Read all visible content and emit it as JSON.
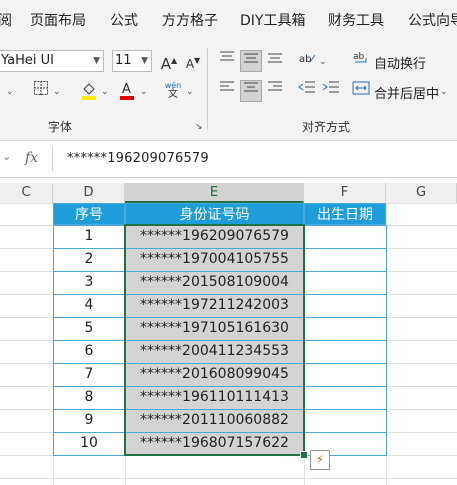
{
  "ribbon_tabs": [
    "阅",
    "页面布局",
    "公式",
    "方方格子",
    "DIY工具箱",
    "财务工具",
    "公式向导"
  ],
  "font_group": {
    "font_name": "YaHei UI",
    "font_size": "11",
    "label": "字体",
    "grow_font": "A",
    "shrink_font": "A",
    "phonetic_top": "wén",
    "phonetic_bottom": "文"
  },
  "align_group": {
    "label": "对齐方式",
    "wrap_text": "自动换行",
    "merge_center": "合并后居中"
  },
  "formula_bar": {
    "fx": "fx",
    "value": "******196209076579"
  },
  "columns": [
    "C",
    "D",
    "E",
    "F",
    "G"
  ],
  "table": {
    "headers": [
      "序号",
      "身份证号码",
      "出生日期"
    ],
    "rows": [
      {
        "no": "1",
        "id": "******196209076579"
      },
      {
        "no": "2",
        "id": "******197004105755"
      },
      {
        "no": "3",
        "id": "******201508109004"
      },
      {
        "no": "4",
        "id": "******197211242003"
      },
      {
        "no": "5",
        "id": "******197105161630"
      },
      {
        "no": "6",
        "id": "******200411234553"
      },
      {
        "no": "7",
        "id": "******201608099045"
      },
      {
        "no": "8",
        "id": "******196110111413"
      },
      {
        "no": "9",
        "id": "******201110060882"
      },
      {
        "no": "10",
        "id": "******196807157622"
      }
    ]
  },
  "accent_color": "#217346",
  "header_fill_color": "#1e9ddb"
}
